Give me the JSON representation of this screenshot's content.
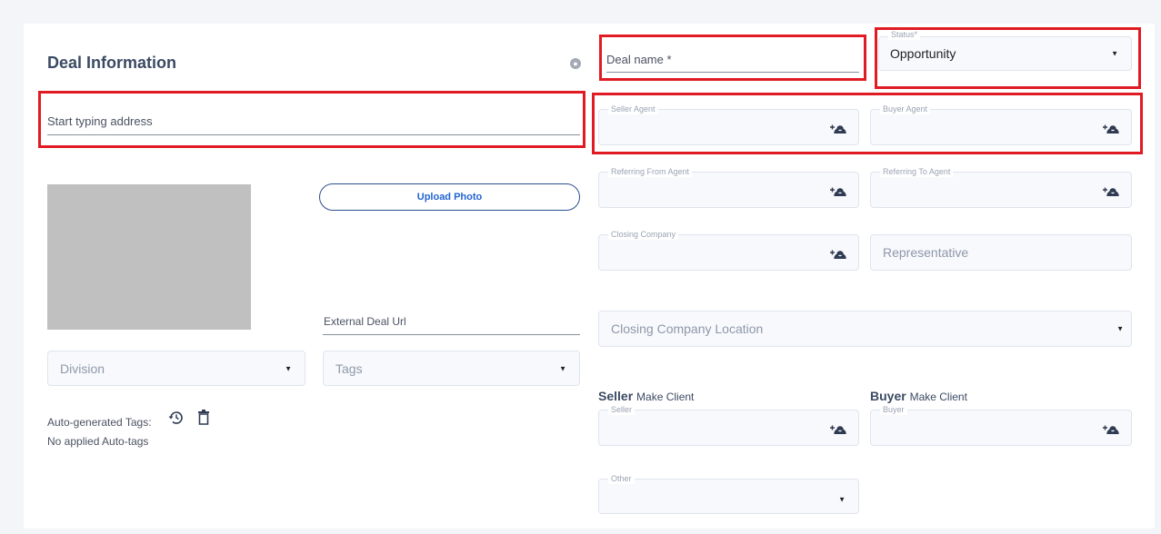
{
  "header": {
    "title": "Deal Information"
  },
  "deal_name": {
    "label": "Deal name *"
  },
  "status": {
    "legend": "Status*",
    "value": "Opportunity"
  },
  "address": {
    "placeholder": "Start typing address"
  },
  "agents": {
    "seller": "Seller Agent",
    "buyer": "Buyer Agent",
    "referring_from": "Referring From Agent",
    "referring_to": "Referring To Agent"
  },
  "closing_company": {
    "legend": "Closing Company"
  },
  "representative": {
    "placeholder": "Representative"
  },
  "closing_company_location": {
    "placeholder": "Closing Company Location"
  },
  "upload_photo": {
    "label": "Upload Photo"
  },
  "external_url": {
    "label": "External Deal Url"
  },
  "division": {
    "placeholder": "Division"
  },
  "tags": {
    "placeholder": "Tags"
  },
  "auto_tags": {
    "label": "Auto-generated Tags:",
    "empty": "No applied Auto-tags"
  },
  "seller_section": {
    "heading": "Seller",
    "make_client": "Make Client",
    "field_legend": "Seller"
  },
  "buyer_section": {
    "heading": "Buyer",
    "make_client": "Make Client",
    "field_legend": "Buyer"
  },
  "other": {
    "legend": "Other"
  },
  "icons": {
    "person_add": "person-add-icon",
    "history": "history-icon",
    "trash": "trash-icon",
    "globe": "globe-icon",
    "dropdown": "chevron-down-icon"
  },
  "colors": {
    "highlight": "#e01b24",
    "accent": "#2364d2",
    "heading": "#3b4a63"
  }
}
